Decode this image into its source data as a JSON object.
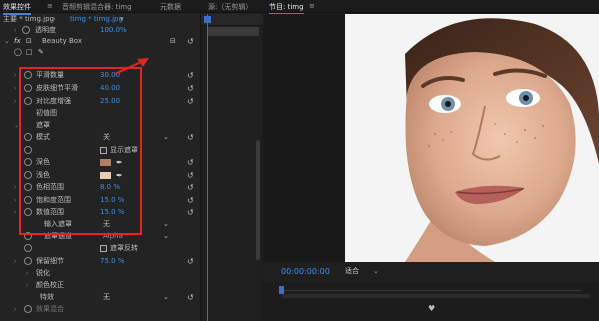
{
  "left": {
    "tabs": [
      "效果控件",
      "音频剪辑混合器: timg",
      "元数据",
      "源:（无剪辑）"
    ],
    "clip": {
      "master": "主要 * timg.jpg",
      "instance": "timg * timg.jpg"
    },
    "rows": {
      "opacity": {
        "label": "透明度",
        "value": "100.0%"
      },
      "beauty": {
        "label": "Beauty Box"
      },
      "smooth": {
        "label": "平滑数量",
        "value": "30.00"
      },
      "detail": {
        "label": "皮肤细节平滑",
        "value": "40.00"
      },
      "contrast": {
        "label": "对比度增强",
        "value": "25.00"
      },
      "defaults": {
        "label": "初值图"
      },
      "mask": {
        "label": "遮罩"
      },
      "mode": {
        "label": "模式",
        "value": "关"
      },
      "show_mask": {
        "label": "显示遮罩"
      },
      "dark": {
        "label": "深色"
      },
      "light": {
        "label": "浅色"
      },
      "hue": {
        "label": "色相范围",
        "value": "8.0 %"
      },
      "sat": {
        "label": "饱和度范围",
        "value": "15.0 %"
      },
      "brightness": {
        "label": "数值范围",
        "value": "15.0 %"
      },
      "input_mask": {
        "label": "输入遮罩",
        "value": "无"
      },
      "mask_channel": {
        "label": "遮罩通道",
        "value": "Alpha"
      },
      "mask_invert": {
        "label": "遮罩反转"
      },
      "retain": {
        "label": "保留细节",
        "value": "75.0 %"
      },
      "sharpen": {
        "label": "锐化"
      },
      "color_correct": {
        "label": "颜色校正"
      },
      "special": {
        "label": "特效",
        "value": "无"
      },
      "fx_blend": {
        "label": "效果混合"
      }
    }
  },
  "right": {
    "tab": "节目: timg",
    "timecode": "00:00:00:00",
    "fit": "适合"
  },
  "colors": {
    "highlight": "#e0261f",
    "accent": "#3e8eea"
  },
  "icons": [
    "reset-icon",
    "stopwatch-icon",
    "eyedropper-icon",
    "keyframe-icon",
    "fx-icon"
  ]
}
